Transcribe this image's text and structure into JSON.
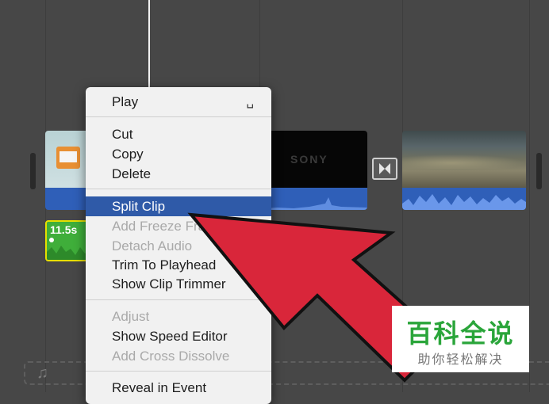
{
  "context_menu": {
    "items": [
      {
        "label": "Play",
        "enabled": true,
        "shortcut": "␣"
      },
      {
        "label": "Cut",
        "enabled": true
      },
      {
        "label": "Copy",
        "enabled": true
      },
      {
        "label": "Delete",
        "enabled": true
      },
      {
        "label": "Split Clip",
        "enabled": true,
        "highlighted": true
      },
      {
        "label": "Add Freeze Frame",
        "enabled": false
      },
      {
        "label": "Detach Audio",
        "enabled": false
      },
      {
        "label": "Trim To Playhead",
        "enabled": true
      },
      {
        "label": "Show Clip Trimmer",
        "enabled": true
      },
      {
        "label": "Adjust",
        "enabled": false
      },
      {
        "label": "Show Speed Editor",
        "enabled": true
      },
      {
        "label": "Add Cross Dissolve",
        "enabled": false
      },
      {
        "label": "Reveal in Event",
        "enabled": true
      }
    ]
  },
  "timeline": {
    "audio_clip_duration": "11.5s",
    "clip_caption": "SONY",
    "music_icon": "music-note-icon",
    "transition_icon": "bowtie-transition-icon"
  },
  "watermark": {
    "title": "百科全说",
    "subtitle": "助你轻松解决"
  },
  "colors": {
    "background": "#474747",
    "menu_highlight": "#2f5aa8",
    "arrow": "#d9263a",
    "audio_track": "#2f5fb8",
    "selected_audio_clip": "#3fae3a",
    "selection_border": "#e6e000"
  }
}
